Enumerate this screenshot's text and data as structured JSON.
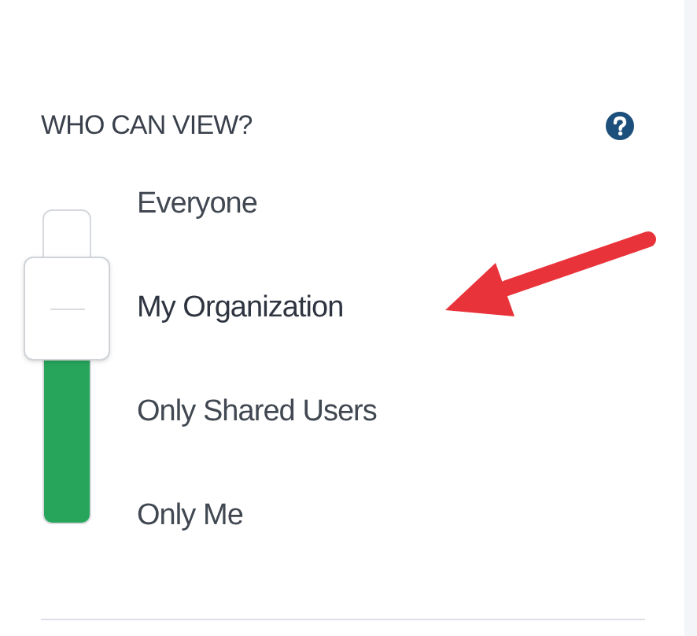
{
  "title": "WHO CAN VIEW?",
  "options": [
    {
      "label": "Everyone",
      "selected": false
    },
    {
      "label": "My Organization",
      "selected": true
    },
    {
      "label": "Only Shared Users",
      "selected": false
    },
    {
      "label": "Only Me",
      "selected": false
    }
  ]
}
